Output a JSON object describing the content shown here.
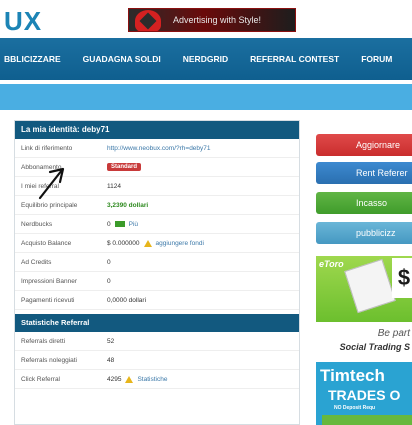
{
  "header": {
    "logo_text": "UX",
    "banner_text": "Advertising with Style!"
  },
  "nav": {
    "items": [
      {
        "label": "BBLICIZZARE"
      },
      {
        "label": "GUADAGNA SOLDI"
      },
      {
        "label": "NERDGRID"
      },
      {
        "label": "REFERRAL CONTEST"
      },
      {
        "label": "FORUM"
      }
    ]
  },
  "identity": {
    "title": "La mia identità: deby71",
    "rows": [
      {
        "label": "Link di riferimento",
        "value": "http://www.neobux.com/?rh=deby71"
      },
      {
        "label": "Abbonamento",
        "value": "Standard"
      },
      {
        "label": "I miei referral",
        "value": "1124"
      },
      {
        "label": "Equilibrio principale",
        "value": "3,2390 dollari"
      },
      {
        "label": "Nerdbucks",
        "value": "0",
        "extra": "Più"
      },
      {
        "label": "Acquisto Balance",
        "value": "$ 0.000000",
        "extra": "aggiungere fondi"
      },
      {
        "label": "Ad Credits",
        "value": "0"
      },
      {
        "label": "Impressioni Banner",
        "value": "0"
      },
      {
        "label": "Pagamenti ricevuti",
        "value": "0,0000 dollari"
      }
    ]
  },
  "referrals": {
    "title": "Statistiche Referral",
    "rows": [
      {
        "label": "Referrals diretti",
        "value": "52"
      },
      {
        "label": "Referrals noleggiati",
        "value": "48"
      },
      {
        "label": "Click Referral",
        "value": "4295",
        "extra": "Statistiche"
      }
    ]
  },
  "sidebar": {
    "buttons": [
      {
        "label": "Aggiornare"
      },
      {
        "label": "Rent Referer"
      },
      {
        "label": "Incasso"
      },
      {
        "label": "pubblicizz"
      }
    ]
  },
  "ad": {
    "brand": "eToro",
    "symbol": "$",
    "tag1": "Be part",
    "tag2": "Social Trading S",
    "headline": "Timtech",
    "sub": "TRADES O",
    "small": "NO Deposit Requ"
  },
  "colors": {
    "nav": "#0f5f8f",
    "strip": "#4aaee2",
    "panel_head": "#12597f",
    "btn_red": "#c92d2d",
    "btn_blue": "#2a6fb0",
    "btn_green": "#3f9c2b",
    "btn_light": "#4598c2"
  }
}
